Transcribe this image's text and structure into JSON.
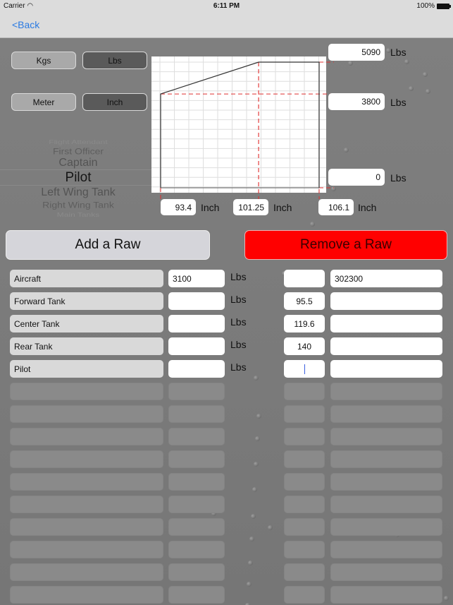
{
  "status_bar": {
    "carrier": "Carrier",
    "wifi_icon": "wifi-icon",
    "time": "6:11 PM",
    "battery": "100%"
  },
  "nav": {
    "back_label": "<Back"
  },
  "units": {
    "weight": [
      {
        "label": "Kgs",
        "selected": false
      },
      {
        "label": "Lbs",
        "selected": true
      }
    ],
    "length": [
      {
        "label": "Meter",
        "selected": false
      },
      {
        "label": "Inch",
        "selected": true
      }
    ]
  },
  "picker": {
    "items": [
      "Flight Attendant",
      "First Officer",
      "Captain",
      "Pilot",
      "Left Wing Tank",
      "Right Wing Tank",
      "Main Tanks"
    ],
    "selected": "Pilot"
  },
  "chart_data": {
    "type": "line",
    "title": "",
    "xlabel": "Inch",
    "ylabel": "Lbs",
    "grid": true,
    "points": [
      {
        "x": 93.4,
        "y": 0
      },
      {
        "x": 93.4,
        "y": 3800
      },
      {
        "x": 101.25,
        "y": 5090
      },
      {
        "x": 106.1,
        "y": 5090
      },
      {
        "x": 106.1,
        "y": 0
      }
    ],
    "x_markers": [
      93.4,
      101.25,
      106.1
    ],
    "y_markers": [
      5090,
      3800,
      0
    ],
    "xlim": [
      92.5,
      106.8
    ],
    "ylim": [
      -500,
      5700
    ]
  },
  "chart_fields": {
    "y_top": "5090",
    "y_mid": "3800",
    "y_bottom": "0",
    "x_left": "93.4",
    "x_mid": "101.25",
    "x_right": "106.1",
    "weight_unit": "Lbs",
    "length_unit": "Inch"
  },
  "actions": {
    "add_label": "Add a Raw",
    "remove_label": "Remove a Raw"
  },
  "rows": [
    {
      "name": "Aircraft",
      "weight": "3100",
      "unit": "Lbs",
      "arm": "",
      "moment": "302300"
    },
    {
      "name": "Forward Tank",
      "weight": "",
      "unit": "Lbs",
      "arm": "95.5",
      "moment": ""
    },
    {
      "name": "Center Tank",
      "weight": "",
      "unit": "Lbs",
      "arm": "119.6",
      "moment": ""
    },
    {
      "name": "Rear Tank",
      "weight": "",
      "unit": "Lbs",
      "arm": "140",
      "moment": ""
    },
    {
      "name": "Pilot",
      "weight": "",
      "unit": "Lbs",
      "arm": "",
      "moment": "",
      "arm_focused": true
    }
  ],
  "empty_row_count": 10
}
